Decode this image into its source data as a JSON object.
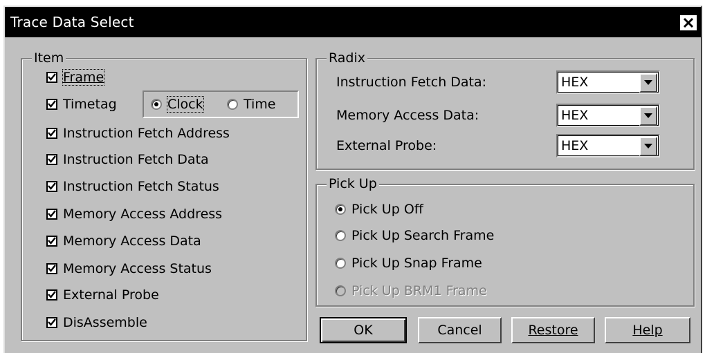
{
  "window": {
    "title": "Trace Data Select",
    "close_label": "Close"
  },
  "item_group": {
    "legend": "Item",
    "items": [
      {
        "label": "Frame",
        "checked": true
      },
      {
        "label": "Timetag",
        "checked": true
      },
      {
        "label": "Instruction Fetch Address",
        "checked": true
      },
      {
        "label": "Instruction Fetch Data",
        "checked": true
      },
      {
        "label": "Instruction Fetch Status",
        "checked": true
      },
      {
        "label": "Memory Access Address",
        "checked": true
      },
      {
        "label": "Memory Access Data",
        "checked": true
      },
      {
        "label": "Memory Access Status",
        "checked": true
      },
      {
        "label": "External Probe",
        "checked": true
      },
      {
        "label": "DisAssemble",
        "checked": true
      }
    ],
    "timetag_options": [
      {
        "label": "Clock",
        "selected": true
      },
      {
        "label": "Time",
        "selected": false
      }
    ]
  },
  "radix_group": {
    "legend": "Radix",
    "rows": [
      {
        "label": "Instruction Fetch Data:",
        "value": "HEX"
      },
      {
        "label": "Memory Access Data:",
        "value": "HEX"
      },
      {
        "label": "External Probe:",
        "value": "HEX"
      }
    ]
  },
  "pickup_group": {
    "legend": "Pick Up",
    "options": [
      {
        "label": "Pick Up Off",
        "selected": true,
        "enabled": true
      },
      {
        "label": "Pick Up Search Frame",
        "selected": false,
        "enabled": true
      },
      {
        "label": "Pick Up Snap Frame",
        "selected": false,
        "enabled": true
      },
      {
        "label": "Pick Up BRM1 Frame",
        "selected": false,
        "enabled": false
      }
    ]
  },
  "buttons": {
    "ok": "OK",
    "cancel": "Cancel",
    "restore": "Restore",
    "help": "Help"
  },
  "colors": {
    "dialog_bg": "#c0c0c0",
    "titlebar_bg": "#000000",
    "title_text": "#ffffff",
    "disabled_text": "#808080"
  }
}
